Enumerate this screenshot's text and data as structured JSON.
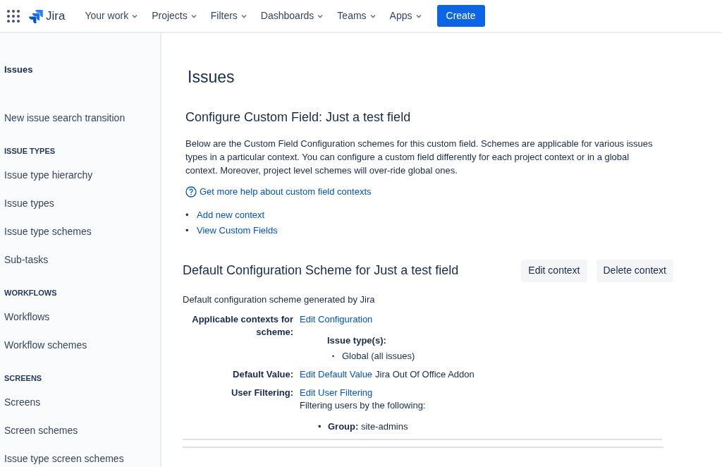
{
  "topnav": {
    "logo": "Jira",
    "menus": [
      "Your work",
      "Projects",
      "Filters",
      "Dashboards",
      "Teams",
      "Apps"
    ],
    "create": "Create"
  },
  "sidebar": {
    "title": "Issues",
    "items": [
      {
        "kind": "link",
        "label": "New issue search transition"
      },
      {
        "kind": "heading",
        "label": "ISSUE TYPES"
      },
      {
        "kind": "link",
        "label": "Issue type hierarchy"
      },
      {
        "kind": "link",
        "label": "Issue types"
      },
      {
        "kind": "link",
        "label": "Issue type schemes"
      },
      {
        "kind": "link",
        "label": "Sub-tasks"
      },
      {
        "kind": "heading",
        "label": "WORKFLOWS"
      },
      {
        "kind": "link",
        "label": "Workflows"
      },
      {
        "kind": "link",
        "label": "Workflow schemes"
      },
      {
        "kind": "heading",
        "label": "SCREENS"
      },
      {
        "kind": "link",
        "label": "Screens"
      },
      {
        "kind": "link",
        "label": "Screen schemes"
      },
      {
        "kind": "link",
        "label": "Issue type screen schemes"
      }
    ]
  },
  "main": {
    "title": "Issues",
    "subtitle": "Configure Custom Field: Just a test field",
    "description": "Below are the Custom Field Configuration schemes for this custom field. Schemes are applicable for various issues types in a particular context. You can configure a custom field differently for each project context or in a global context. Moreover, project level schemes will over-ride global ones.",
    "help_link": "Get more help about custom field contexts",
    "links": [
      {
        "bullet": "•",
        "label": "Add new context"
      },
      {
        "bullet": "•",
        "label": "View Custom Fields"
      }
    ],
    "scheme": {
      "title": "Default Configuration Scheme for Just a test field",
      "buttons": [
        "Edit context",
        "Delete context"
      ],
      "description": "Default configuration scheme generated by Jira",
      "applicable": {
        "label": "Applicable contexts for scheme:",
        "link": "Edit Configuration",
        "issue_types_label": "Issue type(s):",
        "issue_types": [
          {
            "bullet": "•",
            "label": "Global (all issues)"
          }
        ]
      },
      "default_value": {
        "label": "Default Value:",
        "link": "Edit Default Value",
        "value": "Jira Out Of Office Addon"
      },
      "user_filtering": {
        "label": "User Filtering:",
        "link": "Edit User Filtering",
        "note": "Filtering users by the following:",
        "filters": [
          {
            "bullet": "•",
            "label": "**Group:** site-admins"
          }
        ]
      }
    }
  }
}
